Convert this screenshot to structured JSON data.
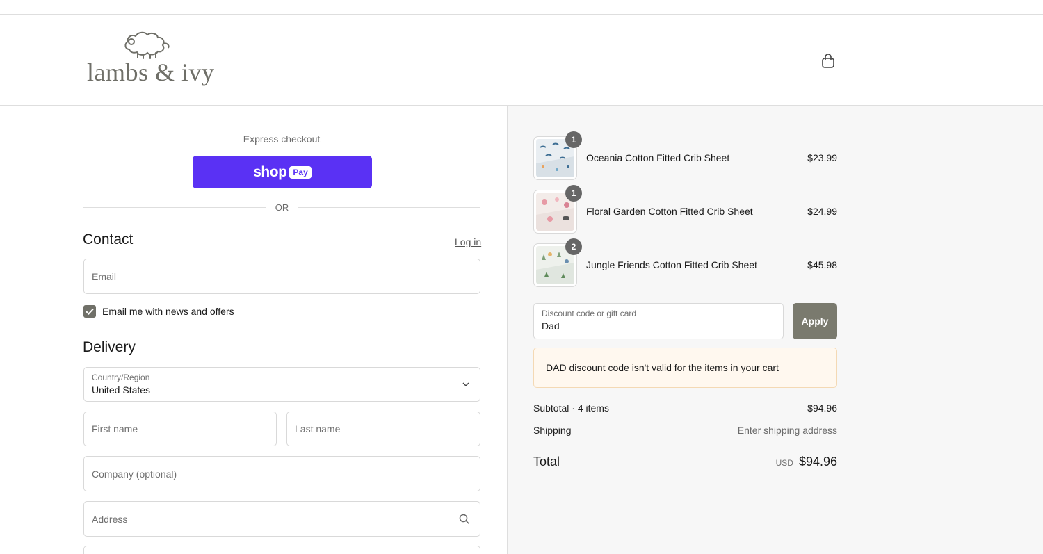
{
  "brand": {
    "name": "lambs & ivy"
  },
  "header": {
    "cart_icon": "shopping-bag-icon"
  },
  "express": {
    "label": "Express checkout",
    "shop_text": "shop",
    "pay_text": "Pay",
    "or_text": "OR"
  },
  "contact": {
    "title": "Contact",
    "login_label": "Log in",
    "email_placeholder": "Email",
    "newsletter_label": "Email me with news and offers",
    "newsletter_checked": true
  },
  "delivery": {
    "title": "Delivery",
    "country_label": "Country/Region",
    "country_value": "United States",
    "first_name_placeholder": "First name",
    "last_name_placeholder": "Last name",
    "company_placeholder": "Company (optional)",
    "address_placeholder": "Address"
  },
  "cart": {
    "items": [
      {
        "name": "Oceania Cotton Fitted Crib Sheet",
        "price": "$23.99",
        "qty": "1"
      },
      {
        "name": "Floral Garden Cotton Fitted Crib Sheet",
        "price": "$24.99",
        "qty": "1"
      },
      {
        "name": "Jungle Friends Cotton Fitted Crib Sheet",
        "price": "$45.98",
        "qty": "2"
      }
    ],
    "discount_label": "Discount code or gift card",
    "discount_value": "Dad",
    "apply_label": "Apply",
    "warning": "DAD discount code isn't valid for the items in your cart",
    "subtotal_label": "Subtotal · 4 items",
    "subtotal_value": "$94.96",
    "shipping_label": "Shipping",
    "shipping_value": "Enter shipping address",
    "total_label": "Total",
    "total_currency": "USD",
    "total_value": "$94.96"
  },
  "colors": {
    "shoppay": "#5a31f4",
    "apply": "#7a7a6e",
    "checkbox": "#707068",
    "warning_bg": "#fff8ef"
  }
}
